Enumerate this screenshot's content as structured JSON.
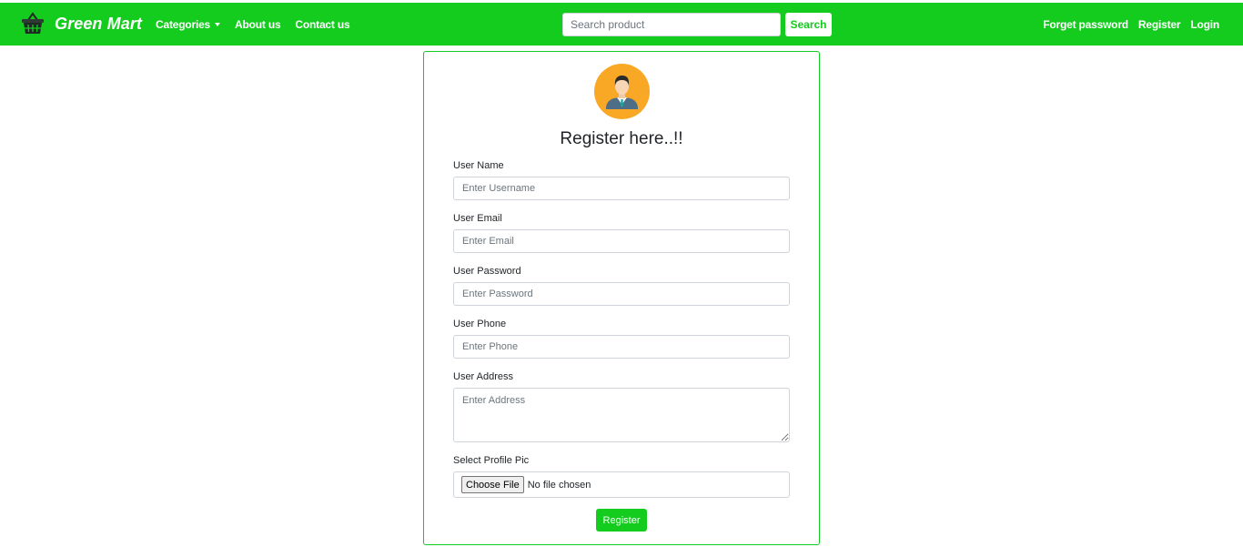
{
  "brand": {
    "name": "Green Mart",
    "icon": "basket-icon",
    "color": "#14cc1e"
  },
  "nav": {
    "categories": "Categories",
    "about": "About us",
    "contact": "Contact us",
    "forget_password": "Forget password",
    "register": "Register",
    "login": "Login"
  },
  "search": {
    "placeholder": "Search product",
    "button": "Search"
  },
  "form": {
    "avatar_icon": "user-avatar-icon",
    "title": "Register here..!!",
    "username": {
      "label": "User Name",
      "placeholder": "Enter Username"
    },
    "email": {
      "label": "User Email",
      "placeholder": "Enter Email"
    },
    "password": {
      "label": "User Password",
      "placeholder": "Enter Password"
    },
    "phone": {
      "label": "User Phone",
      "placeholder": "Enter Phone"
    },
    "address": {
      "label": "User Address",
      "placeholder": "Enter Address"
    },
    "profile_pic": {
      "label": "Select Profile Pic",
      "button": "Choose File",
      "status": "No file chosen"
    },
    "submit": "Register"
  }
}
